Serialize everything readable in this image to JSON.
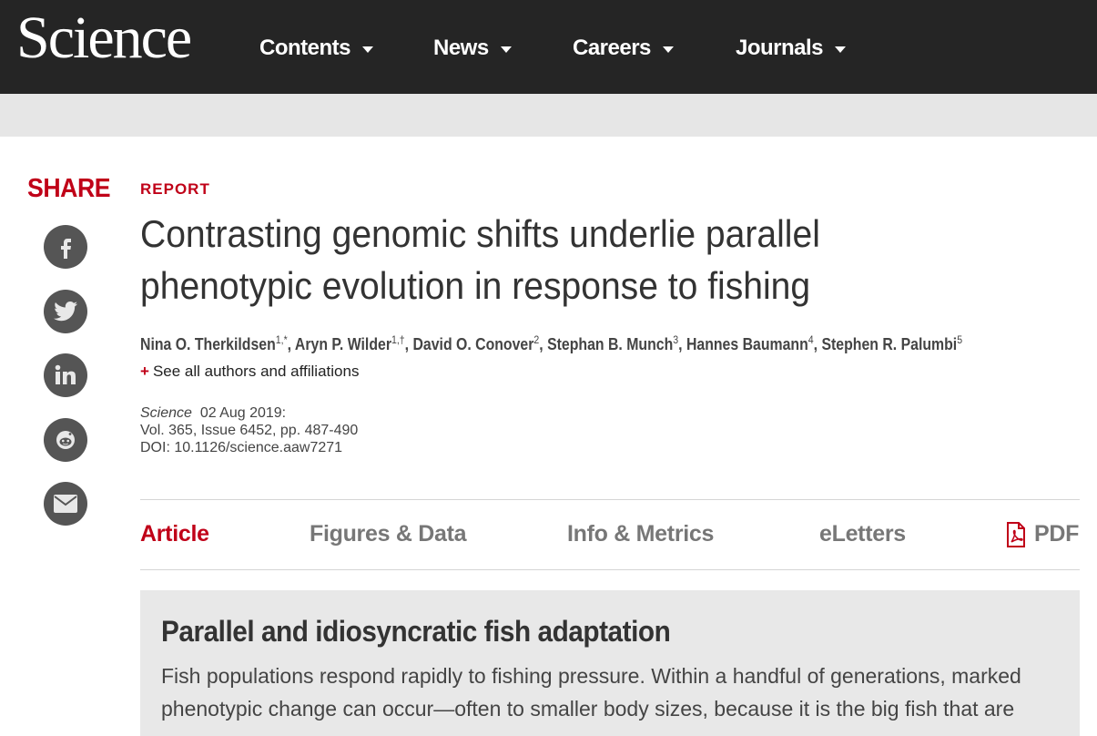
{
  "header": {
    "logo": "Science",
    "nav": [
      "Contents",
      "News",
      "Careers",
      "Journals"
    ]
  },
  "share": {
    "label": "SHARE",
    "buttons": [
      "facebook-icon",
      "twitter-icon",
      "linkedin-icon",
      "reddit-icon",
      "email-icon"
    ]
  },
  "article": {
    "section": "REPORT",
    "title_line1": "Contrasting genomic shifts underlie parallel",
    "title_line2": "phenotypic evolution in response to fishing",
    "authors": [
      {
        "name": "Nina O. Therkildsen",
        "sup": "1,*"
      },
      {
        "name": "Aryn P. Wilder",
        "sup": "1,†"
      },
      {
        "name": "David O. Conover",
        "sup": "2"
      },
      {
        "name": "Stephan B. Munch",
        "sup": "3"
      },
      {
        "name": "Hannes Baumann",
        "sup": "4"
      },
      {
        "name": "Stephen R. Palumbi",
        "sup": "5"
      }
    ],
    "see_all_plus": "+",
    "see_all": "See all authors and affiliations",
    "citation": {
      "journal": "Science",
      "date": "02 Aug 2019:",
      "volume": "Vol. 365, Issue 6452, pp. 487-490",
      "doi": "DOI: 10.1126/science.aaw7271"
    }
  },
  "tabs": {
    "article": "Article",
    "figures": "Figures & Data",
    "info": "Info & Metrics",
    "eletters": "eLetters",
    "pdf": "PDF"
  },
  "abstract": {
    "title": "Parallel and idiosyncratic fish adaptation",
    "line1": "Fish populations respond rapidly to fishing pressure. Within a handful of generations, marked",
    "line2": "phenotypic change can occur—often to smaller body sizes, because it is the big fish that are"
  },
  "colors": {
    "accent": "#c00018",
    "topbar": "#252525",
    "subbar": "#e6e6e6",
    "share_button": "#555555",
    "abstract_bg": "#e8e8e8"
  }
}
